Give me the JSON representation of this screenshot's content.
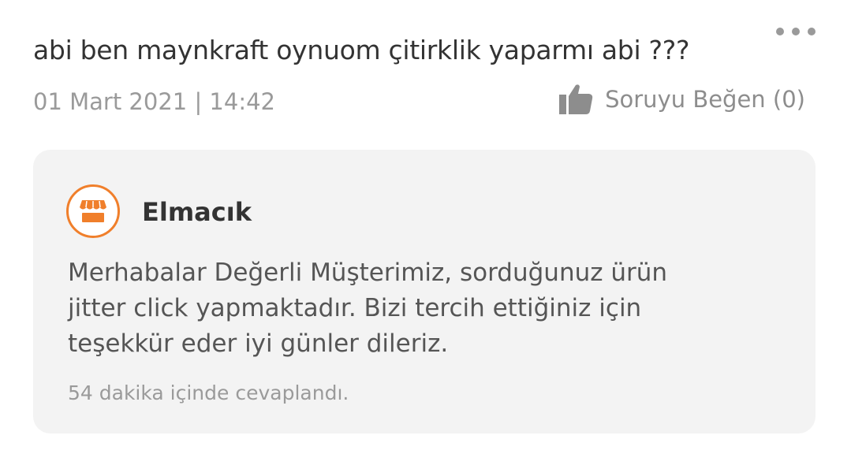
{
  "question": {
    "text": "abi ben maynkraft oynuom çitirklik yaparmı abi ???",
    "date": "01 Mart 2021 | 14:42",
    "like_label": "Soruyu Beğen (0)",
    "more_icon": "more-dots-icon",
    "like_icon": "thumbs-up-icon"
  },
  "answer": {
    "seller_name": "Elmacık",
    "seller_icon": "store-icon",
    "line1": "Merhabalar Değerli Müşterimiz,  sorduğunuz ürün",
    "line2": "jitter click yapmaktadır. Bizi tercih ettiğiniz için",
    "line3": "teşekkür eder iyi günler dileriz.",
    "answered_in": "54 dakika içinde cevaplandı."
  },
  "colors": {
    "accent": "#f07f2b",
    "card_bg": "#f3f3f3",
    "muted_text": "#9a9a9a",
    "primary_text": "#333333"
  }
}
